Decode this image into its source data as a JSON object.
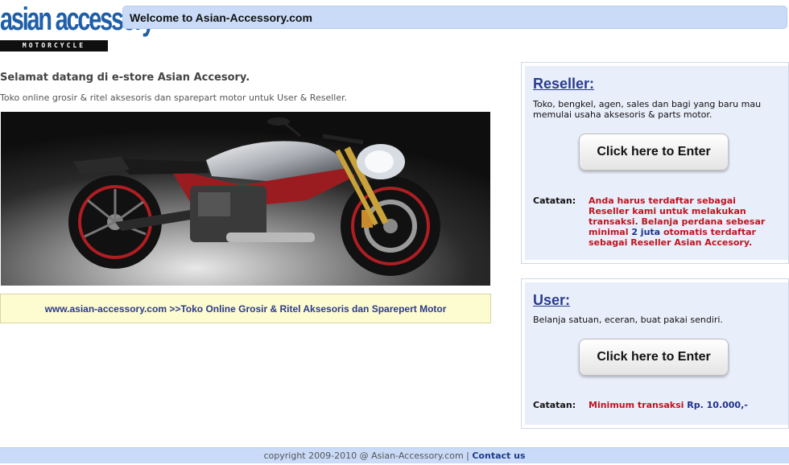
{
  "logo": {
    "main_text": "asian accessory",
    "sub_text": "MOTORCYCLE"
  },
  "header": {
    "title": "Welcome to Asian-Accessory.com"
  },
  "intro": {
    "heading": "Selamat datang di e-store Asian Accesory.",
    "text": "Toko online grosir & ritel aksesoris dan sparepart motor untuk User & Reseller."
  },
  "hero": {
    "image_subject": "motorcycle-photo"
  },
  "tagline": {
    "text": "www.asian-accessory.com >>Toko Online Grosir & Ritel Aksesoris dan Sparepert Motor"
  },
  "reseller": {
    "title": "Reseller:",
    "description": "Toko, bengkel, agen, sales dan bagi yang baru mau memulai usaha aksesoris & parts motor.",
    "button_label": "Click here to Enter",
    "note_label": "Catatan:",
    "note_part1": "Anda harus terdaftar sebagai Reseller kami untuk melakukan transaksi. Belanja perdana sebesar minimal ",
    "note_highlight": "2 juta",
    "note_part2": " otomatis terdaftar sebagai Reseller Asian Accesory."
  },
  "user": {
    "title": "User:",
    "description": "Belanja satuan, eceran, buat pakai sendiri.",
    "button_label": "Click here to Enter",
    "note_label": "Catatan:",
    "note_part1": "Minimum transaksi ",
    "note_highlight": "Rp. 10.000,-"
  },
  "footer": {
    "copyright": "copyright 2009-2010 @ Asian-Accessory.com | ",
    "contact_label": "Contact us"
  },
  "colors": {
    "header_bg": "#c9dbf7",
    "panel_bg": "#e9eefb",
    "title_blue": "#2a3b8f",
    "note_red": "#c0141e",
    "tagline_bg": "#fdfbd0"
  }
}
